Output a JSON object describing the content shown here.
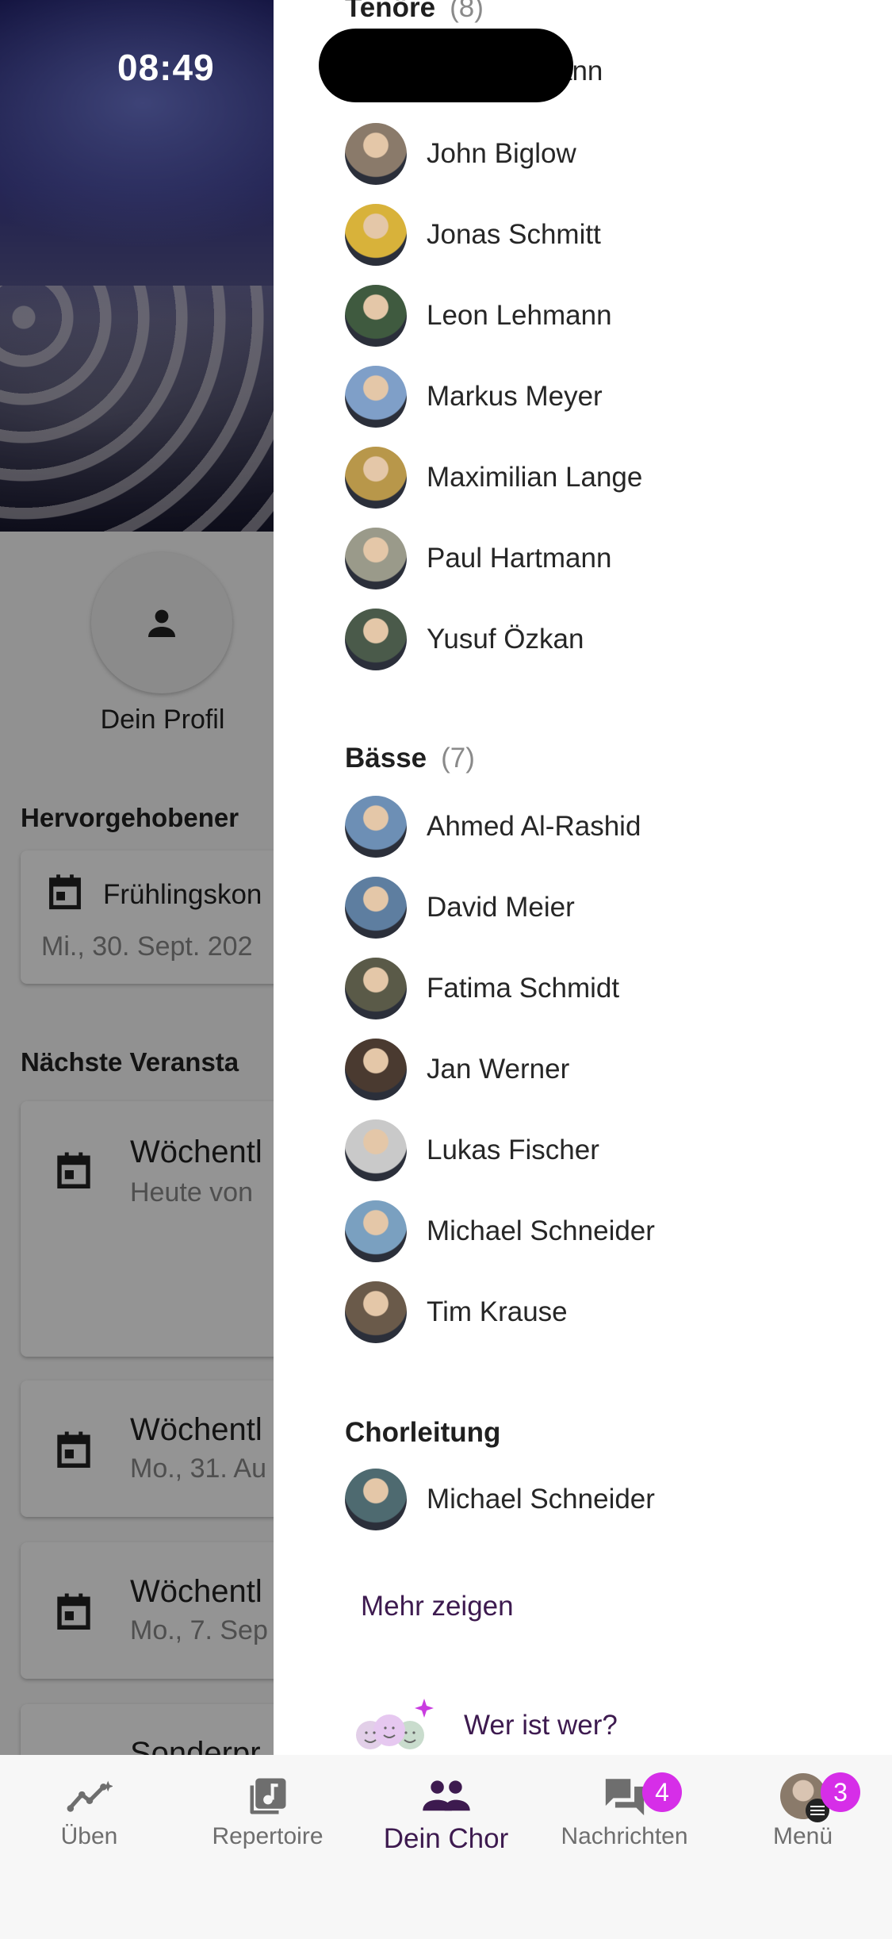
{
  "status_bar": {
    "time": "08:49"
  },
  "background": {
    "profile_label": "Dein Profil",
    "featured_heading": "Hervorgehobener",
    "featured_event": {
      "title": "Frühlingskon",
      "date": "Mi., 30. Sept. 202"
    },
    "upcoming_heading": "Nächste Veransta",
    "events": [
      {
        "title": "Wöchentl",
        "sub": "Heute von"
      },
      {
        "title": "Wöchentl",
        "sub": "Mo., 31. Au"
      },
      {
        "title": "Wöchentl",
        "sub": "Mo., 7. Sep"
      },
      {
        "title": "Sonderpr",
        "sub": ""
      }
    ]
  },
  "drawer": {
    "tenors": {
      "title": "Tenöre",
      "count": "(8)",
      "partial_first": "ann",
      "members": [
        {
          "name": "John Biglow",
          "color": "#8a7a6a"
        },
        {
          "name": "Jonas Schmitt",
          "color": "#d8b23a"
        },
        {
          "name": "Leon Lehmann",
          "color": "#3f5a3f"
        },
        {
          "name": "Markus Meyer",
          "color": "#7f9fc8"
        },
        {
          "name": "Maximilian Lange",
          "color": "#b8974a"
        },
        {
          "name": "Paul Hartmann",
          "color": "#9a9a8a"
        },
        {
          "name": "Yusuf Özkan",
          "color": "#4a5a4a"
        }
      ]
    },
    "basses": {
      "title": "Bässe",
      "count": "(7)",
      "members": [
        {
          "name": "Ahmed Al-Rashid",
          "color": "#6d8fb5"
        },
        {
          "name": "David Meier",
          "color": "#5e7ea0"
        },
        {
          "name": "Fatima Schmidt",
          "color": "#5a5a48"
        },
        {
          "name": "Jan Werner",
          "color": "#4a3a30"
        },
        {
          "name": "Lukas Fischer",
          "color": "#c9c9c9"
        },
        {
          "name": "Michael Schneider",
          "color": "#7aa0c0"
        },
        {
          "name": "Tim Krause",
          "color": "#6a5a4a"
        }
      ]
    },
    "leadership": {
      "title": "Chorleitung",
      "members": [
        {
          "name": "Michael Schneider",
          "color": "#4e6a70"
        }
      ]
    },
    "more_label": "Mehr zeigen",
    "who_is_who_label": "Wer ist wer?"
  },
  "bottom_nav": {
    "items": [
      {
        "label": "Üben",
        "icon": "trend-icon"
      },
      {
        "label": "Repertoire",
        "icon": "music-note-icon"
      },
      {
        "label": "Dein Chor",
        "icon": "group-icon"
      },
      {
        "label": "Nachrichten",
        "icon": "chat-icon",
        "badge": "4"
      },
      {
        "label": "Menü",
        "icon": "avatar-menu-icon",
        "badge": "3"
      }
    ],
    "active": "Dein Chor",
    "accent": "#3d1a4f",
    "badge_color": "#d62ee8"
  }
}
